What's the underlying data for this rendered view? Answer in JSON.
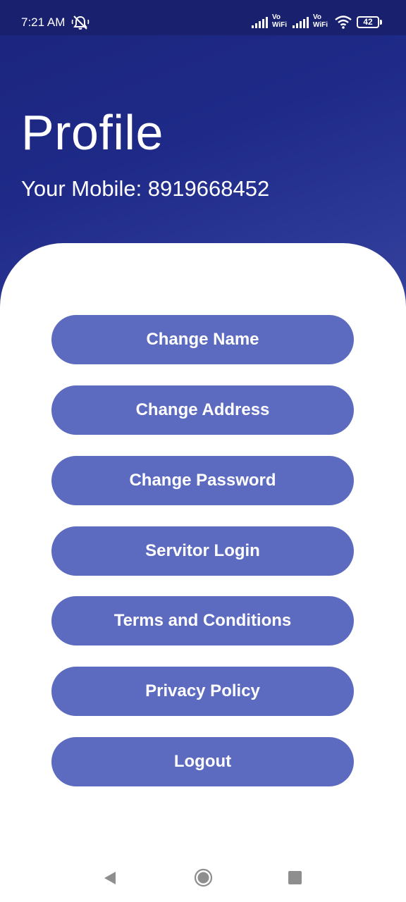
{
  "status_bar": {
    "time": "7:21 AM",
    "battery": "42",
    "vowifi_1": {
      "top": "Vo",
      "bottom": "WiFi"
    },
    "vowifi_2": {
      "top": "Vo",
      "bottom": "WiFi"
    },
    "icons": [
      "dnd-off-icon",
      "signal-icon",
      "vowifi-icon",
      "signal-icon",
      "vowifi-icon",
      "wifi-icon",
      "battery-icon"
    ]
  },
  "header": {
    "title": "Profile",
    "mobile": "Your Mobile: 8919668452"
  },
  "menu": {
    "change_name": "Change Name",
    "change_address": "Change Address",
    "change_password": "Change Password",
    "servitor_login": "Servitor Login",
    "terms": "Terms and Conditions",
    "privacy": "Privacy Policy",
    "logout": "Logout"
  },
  "colors": {
    "header_bg": "#1f2a88",
    "status_bg": "#19216f",
    "button_bg": "#5c6bc0",
    "button_text": "#ffffff"
  },
  "nav_bar": {
    "icons": [
      "back-icon",
      "home-icon",
      "recents-icon"
    ]
  }
}
